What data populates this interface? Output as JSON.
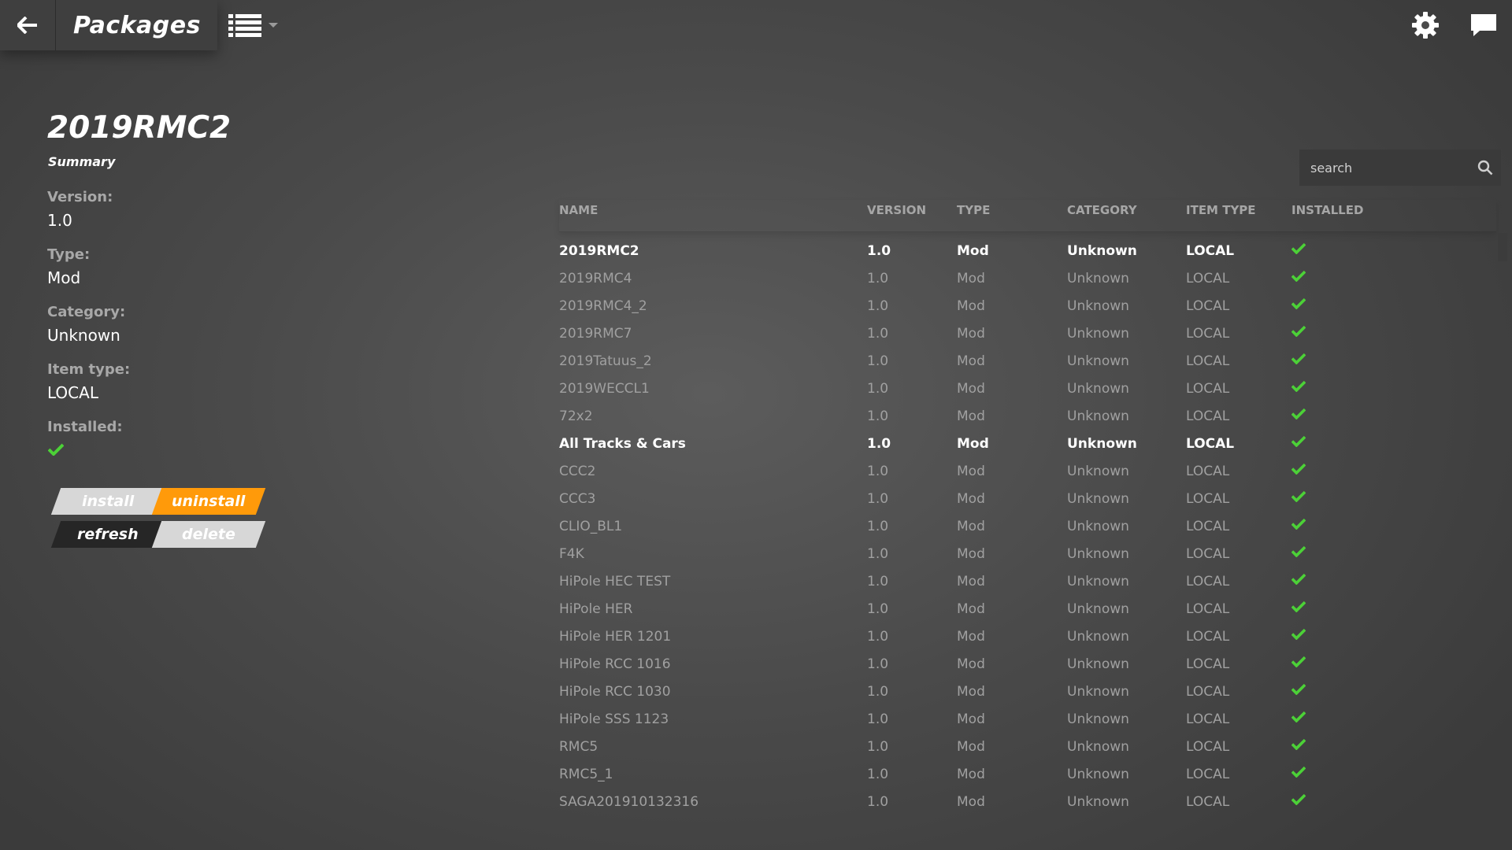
{
  "header": {
    "title": "Packages",
    "back_icon": "arrow-left-icon",
    "view_icon": "list-view-icon",
    "settings_icon": "gear-icon",
    "chat_icon": "chat-bubble-icon"
  },
  "detail": {
    "title": "2019RMC2",
    "subtitle": "Summary",
    "version_label": "Version:",
    "version": "1.0",
    "type_label": "Type:",
    "type": "Mod",
    "category_label": "Category:",
    "category": "Unknown",
    "itemtype_label": "Item type:",
    "itemtype": "LOCAL",
    "installed_label": "Installed:",
    "installed": true
  },
  "actions": {
    "install": "install",
    "uninstall": "uninstall",
    "refresh": "refresh",
    "delete": "delete"
  },
  "search": {
    "placeholder": "search",
    "value": ""
  },
  "table": {
    "columns": [
      "NAME",
      "VERSION",
      "TYPE",
      "CATEGORY",
      "ITEM TYPE",
      "INSTALLED"
    ],
    "rows": [
      {
        "name": "2019RMC2",
        "version": "1.0",
        "type": "Mod",
        "category": "Unknown",
        "itemtype": "LOCAL",
        "installed": true,
        "highlight": true
      },
      {
        "name": "2019RMC4",
        "version": "1.0",
        "type": "Mod",
        "category": "Unknown",
        "itemtype": "LOCAL",
        "installed": true,
        "highlight": false
      },
      {
        "name": "2019RMC4_2",
        "version": "1.0",
        "type": "Mod",
        "category": "Unknown",
        "itemtype": "LOCAL",
        "installed": true,
        "highlight": false
      },
      {
        "name": "2019RMC7",
        "version": "1.0",
        "type": "Mod",
        "category": "Unknown",
        "itemtype": "LOCAL",
        "installed": true,
        "highlight": false
      },
      {
        "name": "2019Tatuus_2",
        "version": "1.0",
        "type": "Mod",
        "category": "Unknown",
        "itemtype": "LOCAL",
        "installed": true,
        "highlight": false
      },
      {
        "name": "2019WECCL1",
        "version": "1.0",
        "type": "Mod",
        "category": "Unknown",
        "itemtype": "LOCAL",
        "installed": true,
        "highlight": false
      },
      {
        "name": "72x2",
        "version": "1.0",
        "type": "Mod",
        "category": "Unknown",
        "itemtype": "LOCAL",
        "installed": true,
        "highlight": false
      },
      {
        "name": "All Tracks & Cars",
        "version": "1.0",
        "type": "Mod",
        "category": "Unknown",
        "itemtype": "LOCAL",
        "installed": true,
        "highlight": true
      },
      {
        "name": "CCC2",
        "version": "1.0",
        "type": "Mod",
        "category": "Unknown",
        "itemtype": "LOCAL",
        "installed": true,
        "highlight": false
      },
      {
        "name": "CCC3",
        "version": "1.0",
        "type": "Mod",
        "category": "Unknown",
        "itemtype": "LOCAL",
        "installed": true,
        "highlight": false
      },
      {
        "name": "CLIO_BL1",
        "version": "1.0",
        "type": "Mod",
        "category": "Unknown",
        "itemtype": "LOCAL",
        "installed": true,
        "highlight": false
      },
      {
        "name": "F4K",
        "version": "1.0",
        "type": "Mod",
        "category": "Unknown",
        "itemtype": "LOCAL",
        "installed": true,
        "highlight": false
      },
      {
        "name": "HiPole HEC TEST",
        "version": "1.0",
        "type": "Mod",
        "category": "Unknown",
        "itemtype": "LOCAL",
        "installed": true,
        "highlight": false
      },
      {
        "name": "HiPole HER",
        "version": "1.0",
        "type": "Mod",
        "category": "Unknown",
        "itemtype": "LOCAL",
        "installed": true,
        "highlight": false
      },
      {
        "name": "HiPole HER 1201",
        "version": "1.0",
        "type": "Mod",
        "category": "Unknown",
        "itemtype": "LOCAL",
        "installed": true,
        "highlight": false
      },
      {
        "name": "HiPole RCC 1016",
        "version": "1.0",
        "type": "Mod",
        "category": "Unknown",
        "itemtype": "LOCAL",
        "installed": true,
        "highlight": false
      },
      {
        "name": "HiPole RCC 1030",
        "version": "1.0",
        "type": "Mod",
        "category": "Unknown",
        "itemtype": "LOCAL",
        "installed": true,
        "highlight": false
      },
      {
        "name": "HiPole SSS 1123",
        "version": "1.0",
        "type": "Mod",
        "category": "Unknown",
        "itemtype": "LOCAL",
        "installed": true,
        "highlight": false
      },
      {
        "name": "RMC5",
        "version": "1.0",
        "type": "Mod",
        "category": "Unknown",
        "itemtype": "LOCAL",
        "installed": true,
        "highlight": false
      },
      {
        "name": "RMC5_1",
        "version": "1.0",
        "type": "Mod",
        "category": "Unknown",
        "itemtype": "LOCAL",
        "installed": true,
        "highlight": false
      },
      {
        "name": "SAGA201910132316",
        "version": "1.0",
        "type": "Mod",
        "category": "Unknown",
        "itemtype": "LOCAL",
        "installed": true,
        "highlight": false
      }
    ]
  },
  "colors": {
    "accent_orange": "#ff9a0a",
    "check_green": "#4cd137",
    "topbar_bg": "#3f3f3f"
  }
}
